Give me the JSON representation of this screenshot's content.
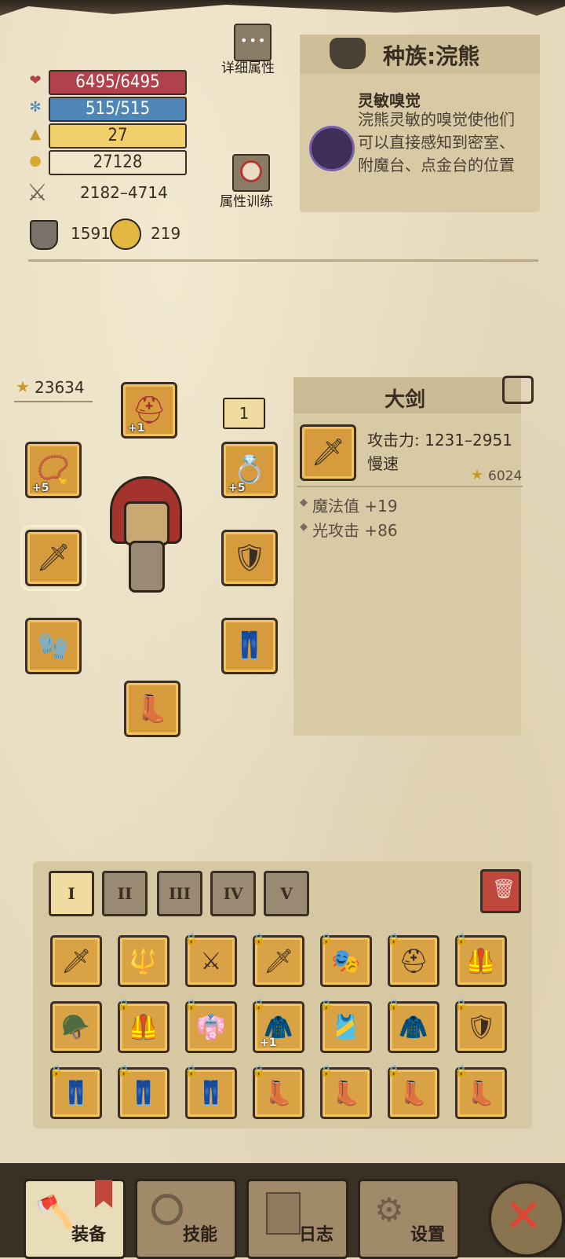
{
  "stats": {
    "hp": "6495/6495",
    "mp": "515/515",
    "level": "27",
    "gold": "27128",
    "attack": "2182–4714",
    "armor": "1591",
    "luck": "219"
  },
  "buttons": {
    "detail_attr": "详细属性",
    "attr_train": "属性训练"
  },
  "race": {
    "title": "种族:浣熊",
    "skill_name": "灵敏嗅觉",
    "skill_desc": "浣熊灵敏的嗅觉使他们可以直接感知到密室、附魔台、点金台的位置"
  },
  "equipment": {
    "total_score": "23634",
    "ring_count": "1",
    "slots": [
      {
        "name": "helmet",
        "plus": "+1"
      },
      {
        "name": "necklace",
        "plus": "+5"
      },
      {
        "name": "ring",
        "plus": "+5"
      },
      {
        "name": "weapon",
        "plus": ""
      },
      {
        "name": "offhand",
        "plus": ""
      },
      {
        "name": "gloves",
        "plus": ""
      },
      {
        "name": "pants",
        "plus": ""
      },
      {
        "name": "boots",
        "plus": ""
      }
    ]
  },
  "item": {
    "name": "大剑",
    "attack": "攻击力: 1231–2951",
    "speed": "慢速",
    "score": "6024",
    "affix1": "魔法值 +19",
    "affix2": "光攻击 +86"
  },
  "inventory": {
    "tabs": [
      "I",
      "II",
      "III",
      "IV",
      "V"
    ],
    "active_tab": 0,
    "row1": [
      "blade",
      "spear",
      "scimitar",
      "thorn-blade",
      "hood",
      "helm",
      "armor"
    ],
    "row2": [
      "chest",
      "armor",
      "demon-armor",
      "cloak",
      "bracer",
      "leather",
      "dark-armor"
    ],
    "row3": [
      "pants",
      "pants",
      "leggings",
      "boots",
      "boots",
      "boots",
      "boots"
    ],
    "cloak_plus": "+1"
  },
  "nav": {
    "equip": "装备",
    "skills": "技能",
    "journal": "日志",
    "settings": "设置"
  },
  "colors": {
    "hp": "#b1414b",
    "mp": "#4f86b8",
    "level": "#f0d06a",
    "slot_gold": "#d69b3c"
  }
}
